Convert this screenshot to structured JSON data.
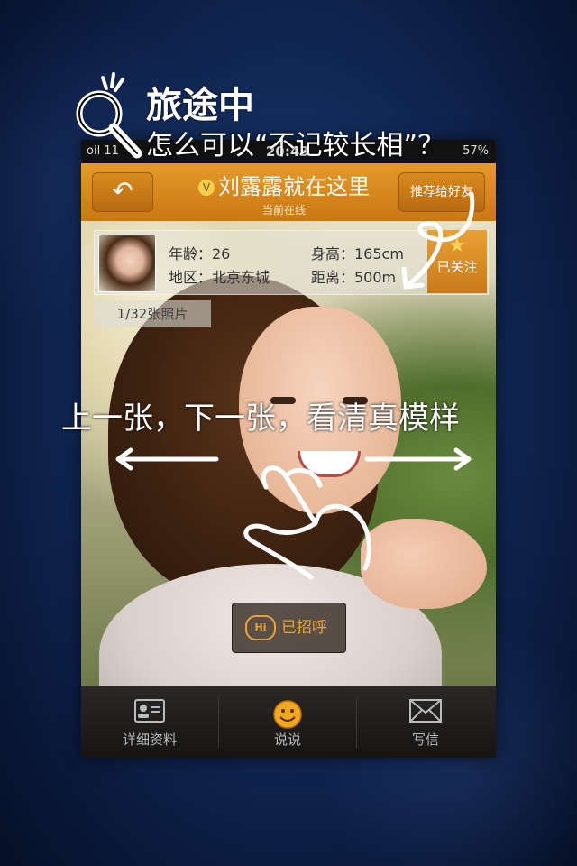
{
  "overlay": {
    "title": "旅途中",
    "subtitle": "怎么可以“不记较长相”？",
    "hint": "上一张，下一张，看清真模样"
  },
  "status_bar": {
    "carrier": "oil 11",
    "time": "20:43",
    "battery": "57%"
  },
  "top_bar": {
    "back_icon": "↶",
    "verified_badge": "V",
    "title": "刘露露就在这里",
    "subtitle": "当前在线",
    "recommend_label": "推荐给好友"
  },
  "profile": {
    "age_label": "年龄：26",
    "height_label": "身高：165cm",
    "area_label": "地区：北京东城",
    "distance_label": "距离：500m",
    "follow_label": "已关注",
    "photo_count": "1/32张照片"
  },
  "greet": {
    "icon_text": "Hi",
    "label": "已招呼"
  },
  "tabs": [
    {
      "label": "详细资料",
      "icon": "profile-card-icon"
    },
    {
      "label": "说说",
      "icon": "smiley-icon"
    },
    {
      "label": "写信",
      "icon": "envelope-icon"
    }
  ],
  "colors": {
    "accent_orange": "#d98a1f",
    "greet_orange": "#e8a33a",
    "background_blue": "#132c5c"
  }
}
